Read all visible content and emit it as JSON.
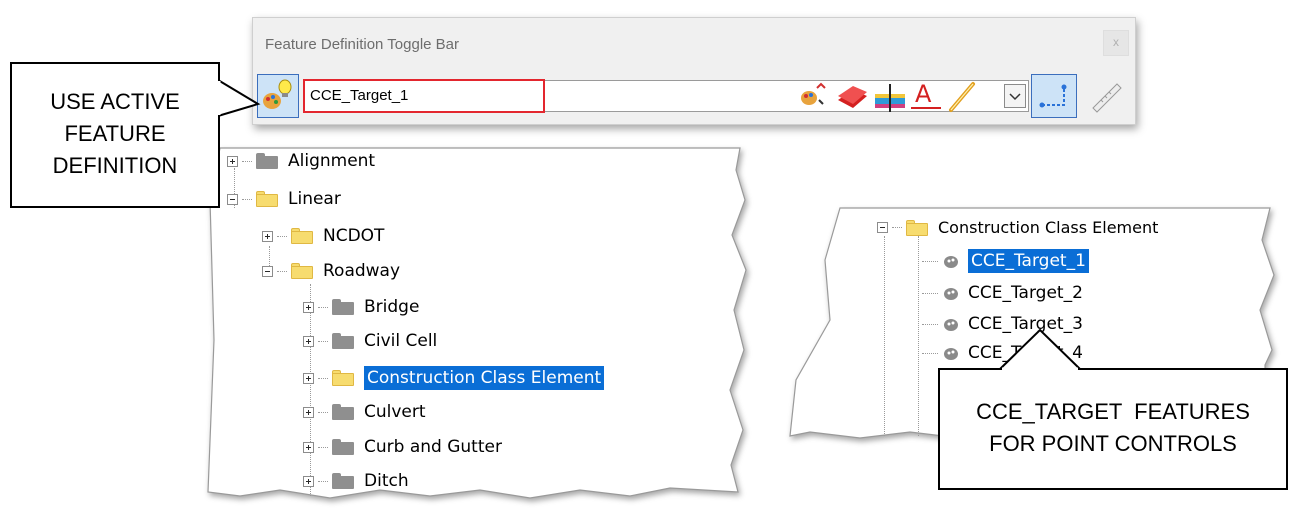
{
  "toolbar": {
    "title": "Feature Definition Toggle Bar",
    "close_label": "x",
    "active_feature_value": "CCE_Target_1"
  },
  "callouts": {
    "left_lines": [
      "USE ACTIVE",
      "FEATURE",
      "DEFINITION"
    ],
    "right_lines": [
      "CCE_TARGET  FEATURES",
      "FOR POINT CONTROLS"
    ]
  },
  "left_tree": {
    "items": [
      {
        "label": "Alignment"
      },
      {
        "label": "Linear"
      },
      {
        "label": "NCDOT"
      },
      {
        "label": "Roadway"
      },
      {
        "label": "Bridge"
      },
      {
        "label": "Civil Cell"
      },
      {
        "label": "Construction Class Element"
      },
      {
        "label": "Culvert"
      },
      {
        "label": "Curb and Gutter"
      },
      {
        "label": "Ditch"
      }
    ]
  },
  "right_tree": {
    "parent": "Construction Class Element",
    "items": [
      {
        "label": "CCE_Target_1"
      },
      {
        "label": "CCE_Target_2"
      },
      {
        "label": "CCE_Target_3"
      },
      {
        "label": "CCE_Target_4"
      }
    ]
  },
  "colors": {
    "selection": "#0a6ed6",
    "highlight_box": "#e3262e",
    "toggle_active_bg": "#cde3f7"
  }
}
